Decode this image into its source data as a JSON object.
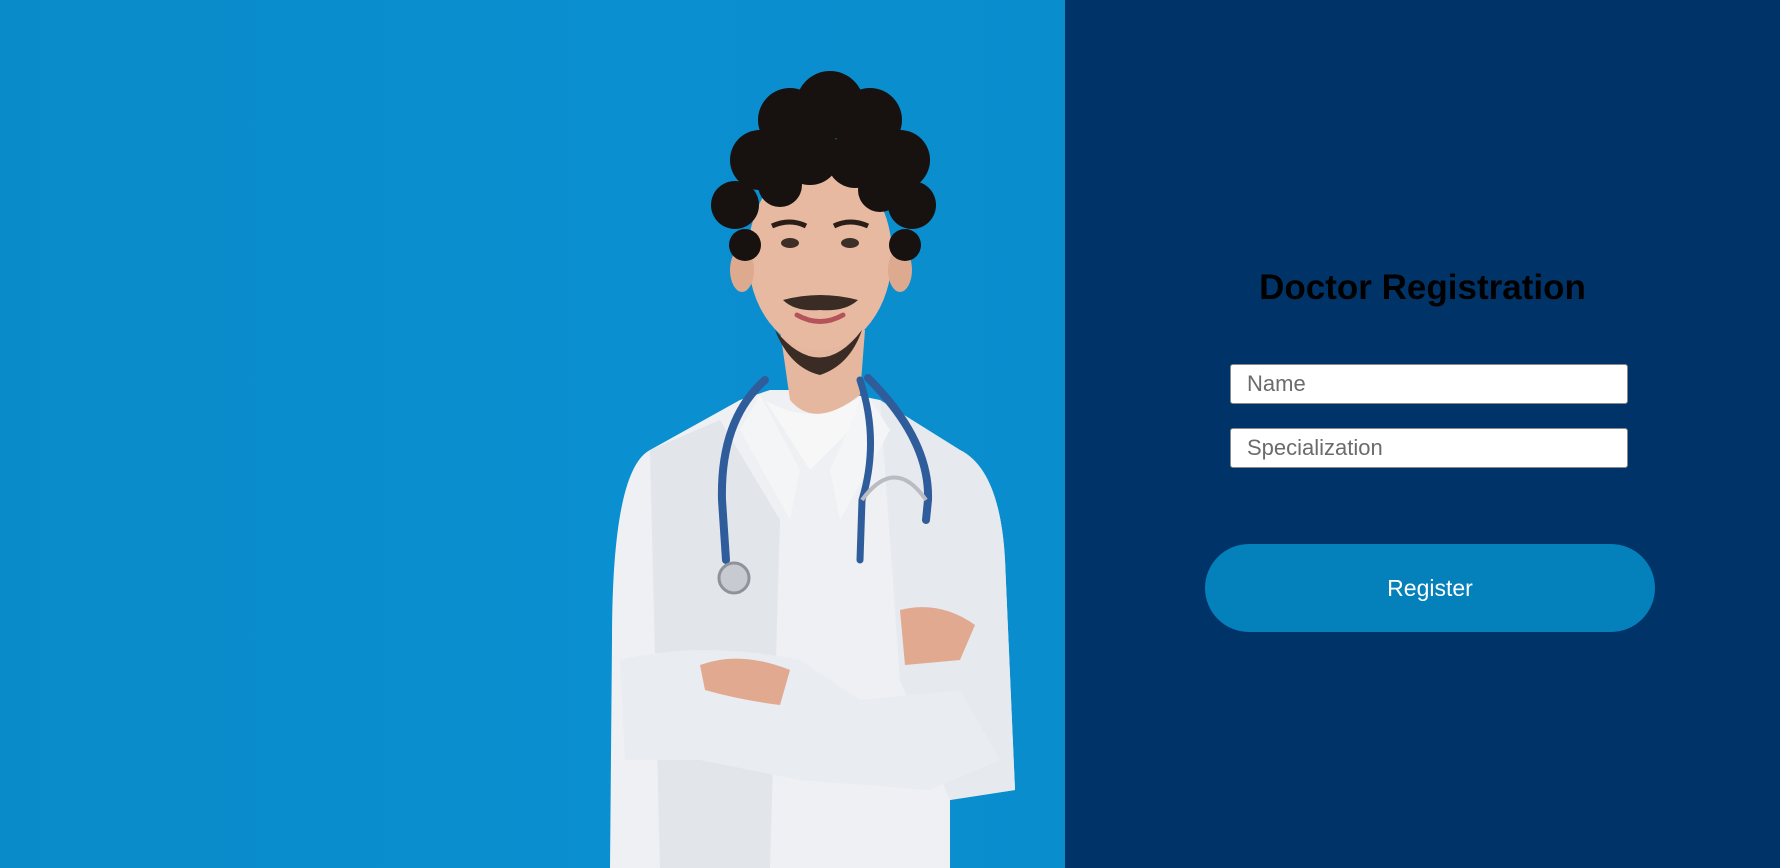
{
  "form": {
    "title": "Doctor Registration",
    "name_placeholder": "Name",
    "specialization_placeholder": "Specialization",
    "register_label": "Register"
  },
  "colors": {
    "photo_background": "#0a8dcd",
    "form_background": "#003468",
    "button": "#0480bb",
    "title_text": "#000000"
  }
}
